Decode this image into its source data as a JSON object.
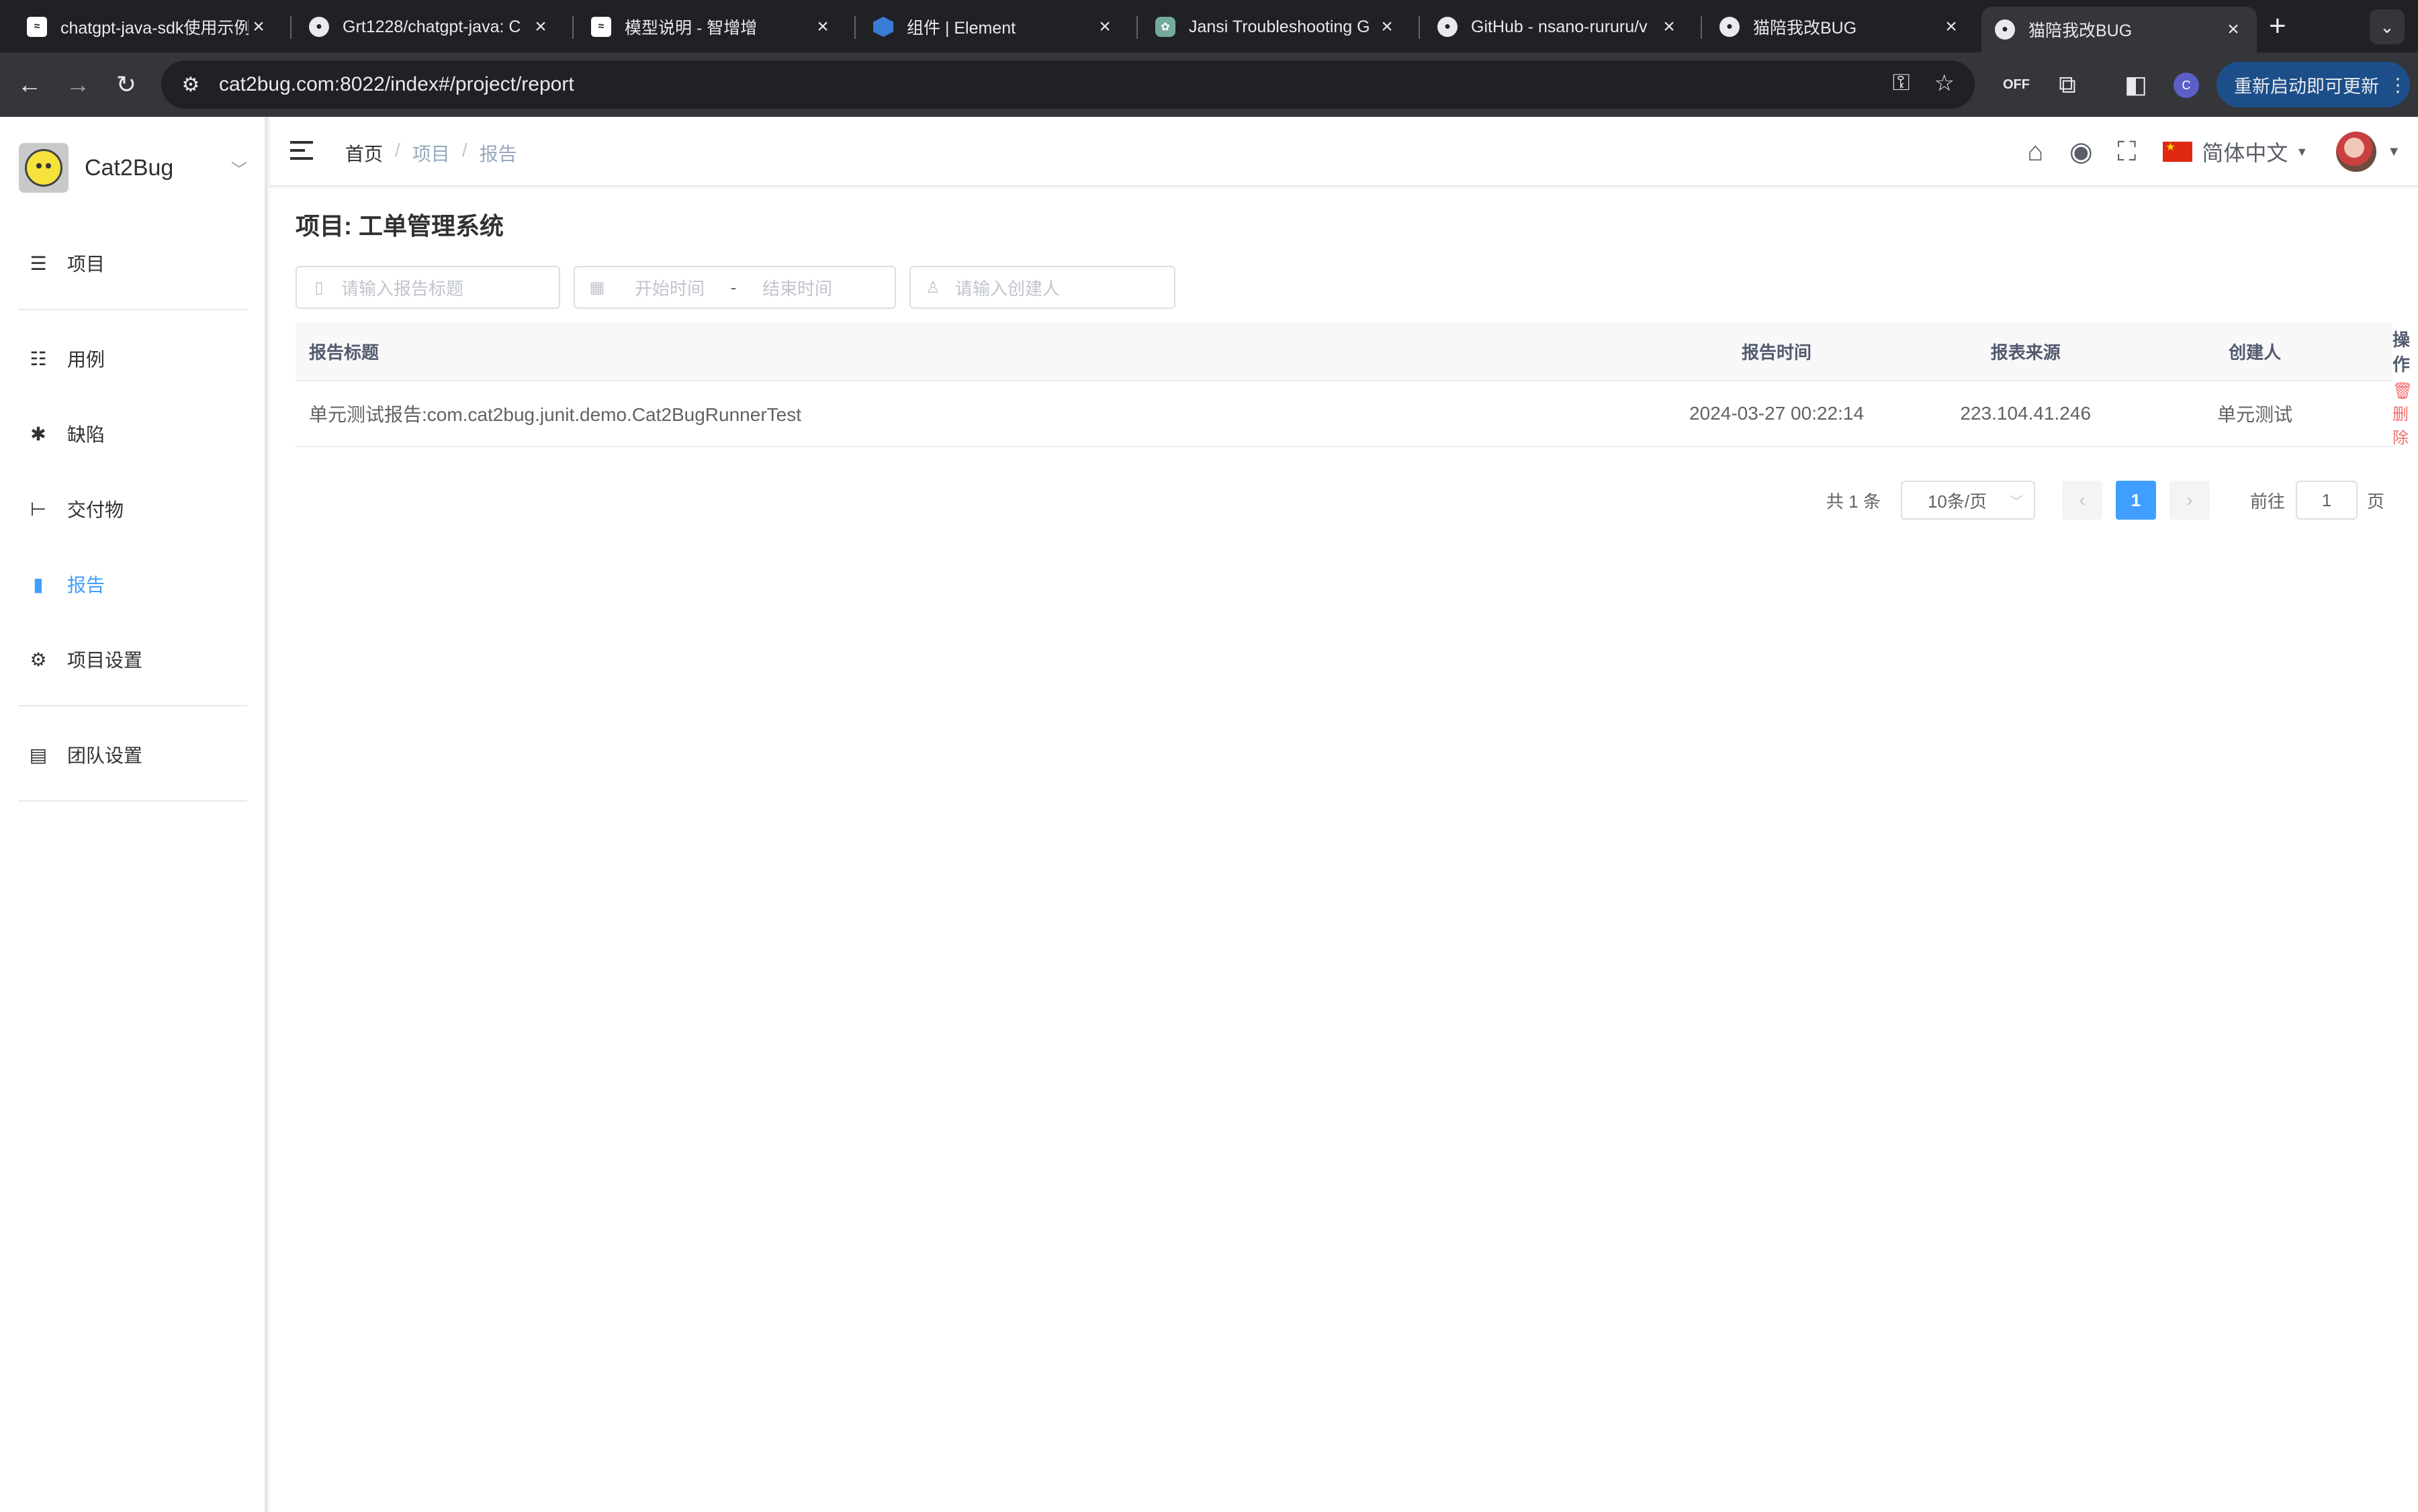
{
  "browser": {
    "tabs": [
      {
        "title": "chatgpt-java-sdk使用示例",
        "icon": "chatgpt-page-favicon"
      },
      {
        "title": "Grt1228/chatgpt-java: C",
        "icon": "github-icon"
      },
      {
        "title": "模型说明 - 智增增",
        "icon": "page-favicon"
      },
      {
        "title": "组件 | Element",
        "icon": "element-icon"
      },
      {
        "title": "Jansi Troubleshooting G",
        "icon": "openai-icon"
      },
      {
        "title": "GitHub - nsano-rururu/v",
        "icon": "github-icon"
      },
      {
        "title": "猫陪我改BUG",
        "icon": "github-icon"
      },
      {
        "title": "猫陪我改BUG",
        "icon": "github-icon",
        "active": true
      }
    ],
    "url": "cat2bug.com:8022/index#/project/report",
    "update_button": "重新启动即可更新",
    "profile_initial": "C",
    "extension_badge": "OFF"
  },
  "sidebar": {
    "brand": "Cat2Bug",
    "items": [
      {
        "label": "项目",
        "icon": "list-icon"
      },
      {
        "label": "用例",
        "icon": "case-list-icon"
      },
      {
        "label": "缺陷",
        "icon": "bug-icon"
      },
      {
        "label": "交付物",
        "icon": "tree-icon"
      },
      {
        "label": "报告",
        "icon": "bar-chart-icon",
        "active": true
      },
      {
        "label": "项目设置",
        "icon": "gear-icon"
      },
      {
        "label": "团队设置",
        "icon": "team-doc-icon"
      }
    ]
  },
  "navbar": {
    "breadcrumb": [
      "首页",
      "项目",
      "报告"
    ],
    "language": "简体中文"
  },
  "main": {
    "title": "项目: 工单管理系统",
    "filters": {
      "title_placeholder": "请输入报告标题",
      "start_placeholder": "开始时间",
      "range_sep": "-",
      "end_placeholder": "结束时间",
      "creator_placeholder": "请输入创建人"
    },
    "table": {
      "headers": [
        "报告标题",
        "报告时间",
        "报表来源",
        "创建人",
        "操作"
      ],
      "rows": [
        {
          "title": "单元测试报告:com.cat2bug.junit.demo.Cat2BugRunnerTest",
          "time": "2024-03-27 00:22:14",
          "source": "223.104.41.246",
          "creator": "单元测试",
          "action": "删除"
        }
      ]
    },
    "pagination": {
      "total_text": "共 1 条",
      "page_size": "10条/页",
      "current_page": "1",
      "goto_label": "前往",
      "goto_value": "1",
      "page_suffix": "页"
    }
  },
  "colors": {
    "accent": "#409eff",
    "danger": "#f56c6c",
    "chrome_dark": "#202124"
  }
}
